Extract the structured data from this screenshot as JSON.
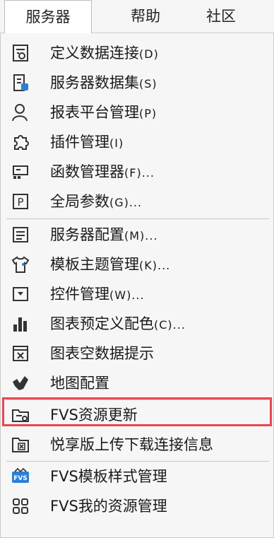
{
  "menubar": {
    "tabs": [
      {
        "label": "服务器"
      },
      {
        "label": "帮助"
      },
      {
        "label": "社区"
      }
    ]
  },
  "menu": {
    "items": [
      {
        "label": "定义数据连接",
        "hotkey": "(D)",
        "icon": "data-connection-icon"
      },
      {
        "label": "服务器数据集",
        "hotkey": "(S)",
        "icon": "server-dataset-icon"
      },
      {
        "label": "报表平台管理",
        "hotkey": "(P)",
        "icon": "user-icon"
      },
      {
        "label": "插件管理",
        "hotkey": "(I)",
        "icon": "plugin-icon"
      },
      {
        "label": "函数管理器",
        "hotkey": "(F)...",
        "icon": "function-manager-icon"
      },
      {
        "label": "全局参数",
        "hotkey": "(G)...",
        "icon": "parameter-icon"
      },
      {
        "label": "服务器配置",
        "hotkey": "(M)...",
        "icon": "server-config-icon"
      },
      {
        "label": "模板主题管理",
        "hotkey": "(K)...",
        "icon": "shirt-theme-icon"
      },
      {
        "label": "控件管理",
        "hotkey": "(W)...",
        "icon": "widget-icon"
      },
      {
        "label": "图表预定义配色",
        "hotkey": "(C)...",
        "icon": "bar-chart-icon"
      },
      {
        "label": "图表空数据提示",
        "hotkey": "",
        "icon": "empty-chart-icon"
      },
      {
        "label": "地图配置",
        "hotkey": "",
        "icon": "map-icon"
      },
      {
        "label": "FVS资源更新",
        "hotkey": "",
        "icon": "folder-sync-icon"
      },
      {
        "label": "悦享版上传下载连接信息",
        "hotkey": "",
        "icon": "folder-upload-icon"
      },
      {
        "label": "FVS模板样式管理",
        "hotkey": "",
        "icon": "fvs-icon"
      },
      {
        "label": "FVS我的资源管理",
        "hotkey": "",
        "icon": "grid-resource-icon"
      }
    ]
  },
  "highlight_color": "#e8474f"
}
